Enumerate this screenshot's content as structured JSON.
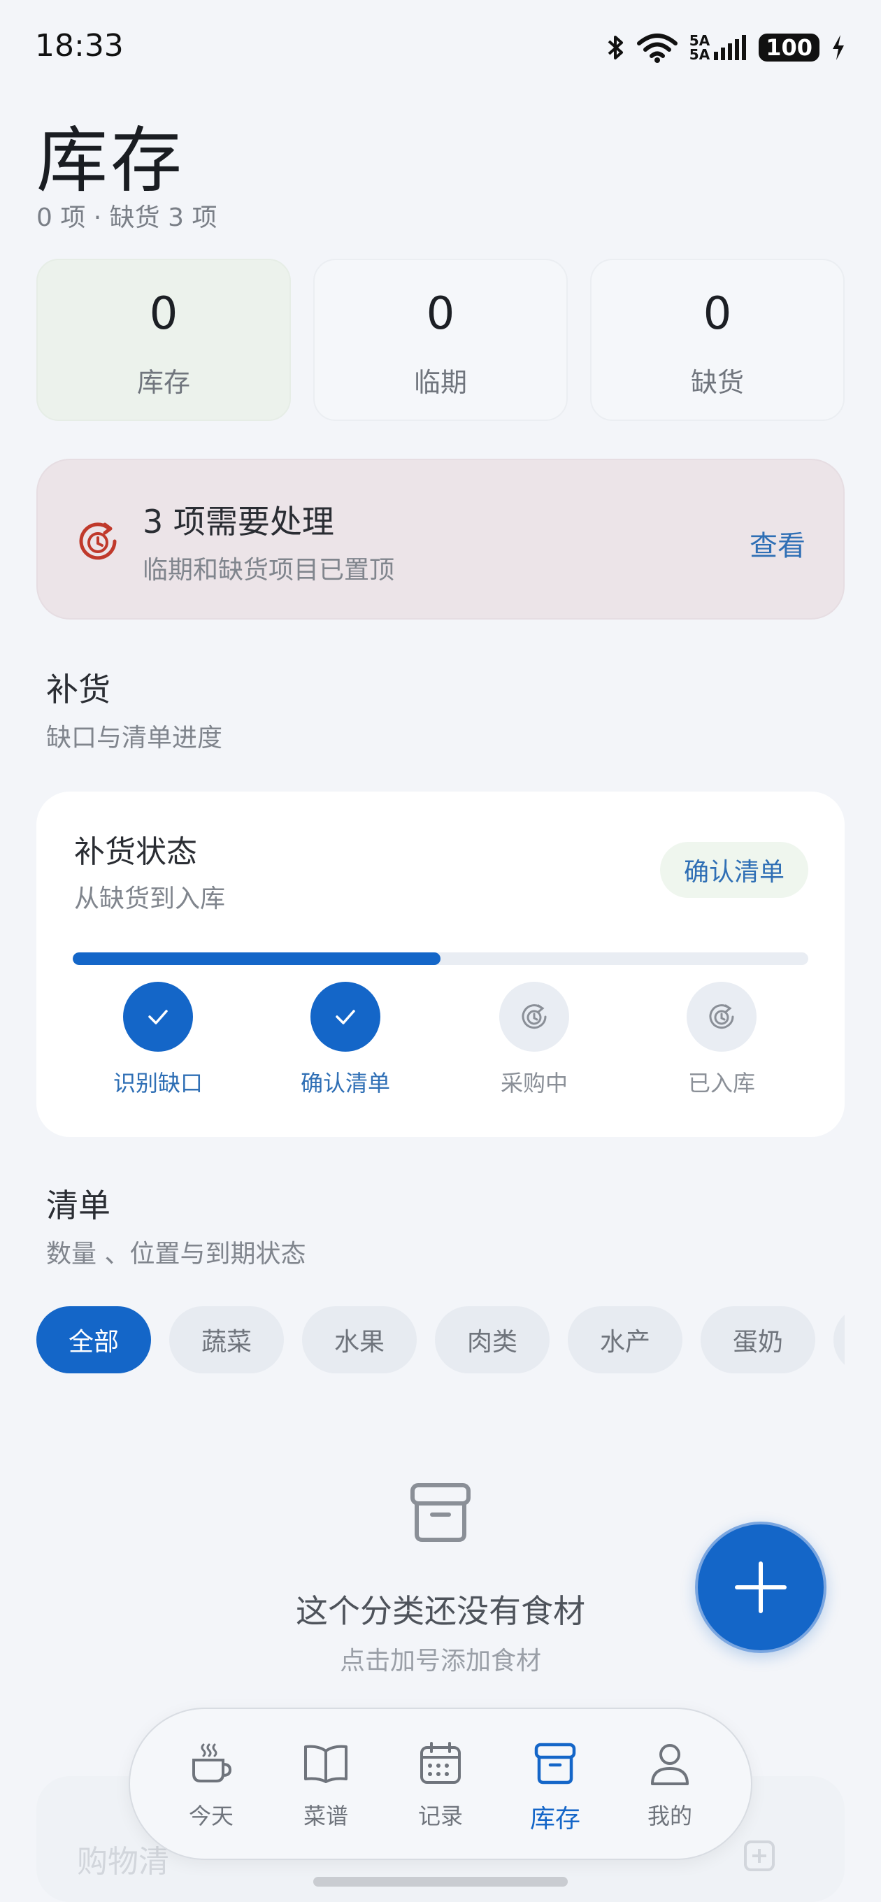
{
  "status_bar": {
    "time": "18:33",
    "network_label": "5A",
    "battery": "100"
  },
  "header": {
    "title": "库存",
    "subtitle": "0 项 · 缺货 3 项"
  },
  "stats": [
    {
      "value": "0",
      "label": "库存"
    },
    {
      "value": "0",
      "label": "临期"
    },
    {
      "value": "0",
      "label": "缺货"
    }
  ],
  "alert": {
    "title": "3 项需要处理",
    "description": "临期和缺货项目已置顶",
    "action": "查看",
    "icon": "clock-refresh-icon",
    "color": "#c0392b"
  },
  "restock_section": {
    "title": "补货",
    "description": "缺口与清单进度"
  },
  "restock_card": {
    "title": "补货状态",
    "subtitle": "从缺货到入库",
    "badge": "确认清单",
    "progress": 0.5,
    "steps": [
      {
        "label": "识别缺口",
        "done": true
      },
      {
        "label": "确认清单",
        "done": true
      },
      {
        "label": "采购中",
        "done": false
      },
      {
        "label": "已入库",
        "done": false
      }
    ]
  },
  "list_section": {
    "title": "清单",
    "description": "数量 、位置与到期状态"
  },
  "filters": [
    "全部",
    "蔬菜",
    "水果",
    "肉类",
    "水产",
    "蛋奶",
    ""
  ],
  "empty_state": {
    "title": "这个分类还没有食材",
    "description": "点击加号添加食材",
    "icon": "box-icon"
  },
  "ghost": {
    "text": "购物清"
  },
  "nav": [
    {
      "label": "今天",
      "icon": "coffee-icon"
    },
    {
      "label": "菜谱",
      "icon": "book-icon"
    },
    {
      "label": "记录",
      "icon": "calendar-icon"
    },
    {
      "label": "库存",
      "icon": "box-icon",
      "active": true
    },
    {
      "label": "我的",
      "icon": "person-icon"
    }
  ],
  "colors": {
    "accent": "#1466c8",
    "link": "#2f6fb5",
    "alert_bg": "#ece4e8"
  }
}
